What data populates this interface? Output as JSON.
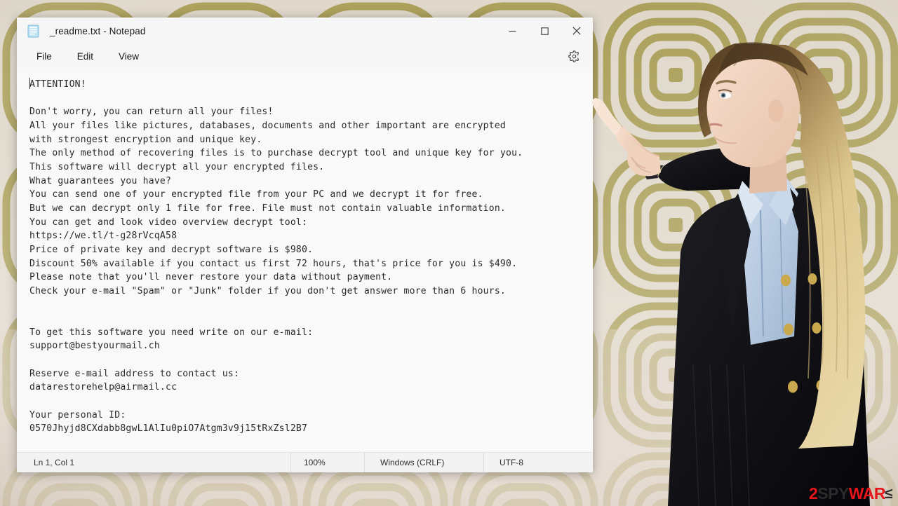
{
  "window": {
    "title": "_readme.txt - Notepad",
    "app_icon": "notepad-icon",
    "controls": {
      "minimize": "minimize-icon",
      "maximize": "maximize-icon",
      "close": "close-icon"
    }
  },
  "menubar": {
    "items": [
      {
        "label": "File"
      },
      {
        "label": "Edit"
      },
      {
        "label": "View"
      }
    ],
    "settings_icon": "gear-icon"
  },
  "document": {
    "body": "ATTENTION!\n\nDon't worry, you can return all your files!\nAll your files like pictures, databases, documents and other important are encrypted\nwith strongest encryption and unique key.\nThe only method of recovering files is to purchase decrypt tool and unique key for you.\nThis software will decrypt all your encrypted files.\nWhat guarantees you have?\nYou can send one of your encrypted file from your PC and we decrypt it for free.\nBut we can decrypt only 1 file for free. File must not contain valuable information.\nYou can get and look video overview decrypt tool:\nhttps://we.tl/t-g28rVcqA58\nPrice of private key and decrypt software is $980.\nDiscount 50% available if you contact us first 72 hours, that's price for you is $490.\nPlease note that you'll never restore your data without payment.\nCheck your e-mail \"Spam\" or \"Junk\" folder if you don't get answer more than 6 hours.\n\n\nTo get this software you need write on our e-mail:\nsupport@bestyourmail.ch\n\nReserve e-mail address to contact us:\ndatarestorehelp@airmail.cc\n\nYour personal ID:\n0570Jhyjd8CXdabb8gwL1AlIu0piO7Atgm3v9j15tRxZsl2B7"
  },
  "statusbar": {
    "position": "Ln 1, Col 1",
    "zoom": "100%",
    "line_ending": "Windows (CRLF)",
    "encoding": "UTF-8"
  },
  "watermark": {
    "prefix": "2",
    "mid": "SPY",
    "suffix": "WAR",
    "arrow": "≤"
  },
  "colors": {
    "window_bg": "#f6f6f6",
    "editor_bg": "#f9f9f9",
    "text": "#2a2a2a",
    "wallpaper_olive": "#a79b52",
    "wallpaper_base": "#d9cfc2",
    "watermark_red": "#e8141c",
    "watermark_dark": "#2b2b2b"
  }
}
